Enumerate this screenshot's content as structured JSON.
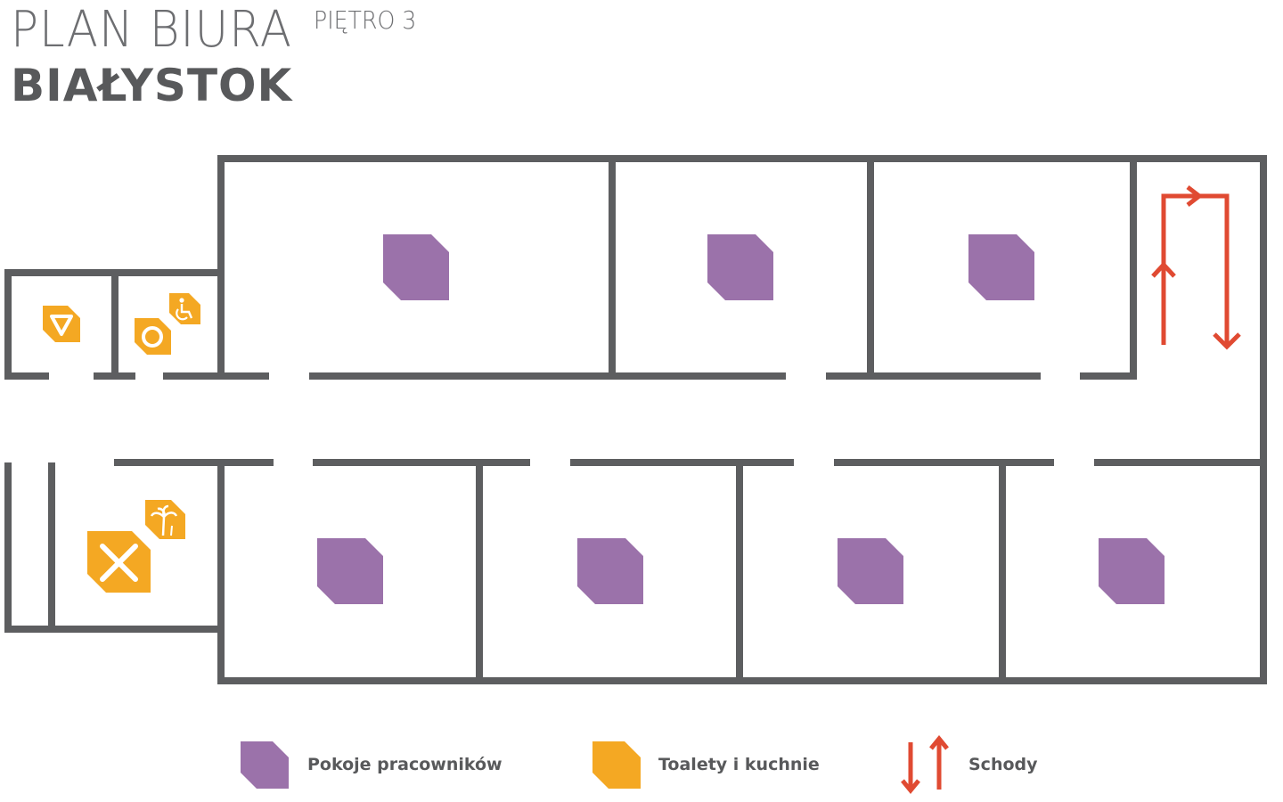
{
  "header": {
    "title": "PLAN BIURA",
    "floor": "PIĘTRO 3",
    "city": "BIAŁYSTOK"
  },
  "legend": [
    {
      "label": "Pokoje pracowników",
      "color": "#9b72aa"
    },
    {
      "label": "Toalety i kuchnie",
      "color": "#f4a823"
    },
    {
      "label": "Schody",
      "color": "#e04a32"
    }
  ],
  "colors": {
    "walls": "#5d5e60",
    "employee_rooms": "#9b72aa",
    "toilets_kitchens": "#f4a823",
    "stairs": "#e04a32"
  },
  "icons": [
    "women-toilet-icon",
    "men-toilet-icon",
    "accessible-toilet-icon",
    "kitchen-icon",
    "relax-palm-icon",
    "stairs-arrow-icon"
  ]
}
